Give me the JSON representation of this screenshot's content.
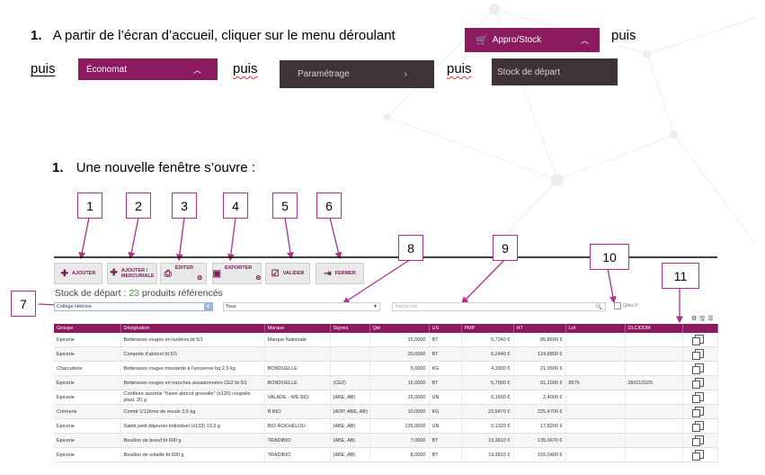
{
  "instructions": {
    "step1_number": "1.",
    "step1_text": "A partir de l’écran d’accueil, cliquer sur le menu déroulant",
    "puis": "puis",
    "step2_number": "1.",
    "step2_text": "Une nouvelle fenêtre s’ouvre :"
  },
  "menus": {
    "appro_stock": "Appro/Stock",
    "economat": "Économat",
    "parametrage": "Paramétrage",
    "stock_depart": "Stock de départ"
  },
  "callouts": [
    "1",
    "2",
    "3",
    "4",
    "5",
    "6",
    "7",
    "8",
    "9",
    "10",
    "11"
  ],
  "toolbar": {
    "ajouter": "AJOUTER",
    "ajouter_mercuriale_1": "AJOUTER /",
    "ajouter_mercuriale_2": "MERCURIALE",
    "editer": "ÉDITER",
    "exporter": "EXPORTER",
    "valider": "VALIDER",
    "fermer": "FERMER"
  },
  "app": {
    "title_prefix": "Stock de départ : ",
    "count": "23",
    "title_suffix": " produits référencés",
    "select_site": "Collège Héloïse",
    "select_all": "Tous",
    "search_placeholder": "Recherche",
    "qtes_zero": "Qtés 0"
  },
  "table": {
    "headers": [
      "Groupe",
      "Désignation",
      "Marque",
      "Signes",
      "Qté",
      "US",
      "PMP",
      "HT",
      "Lot",
      "DLC/DDM",
      ""
    ],
    "rows": [
      [
        "Epicerie",
        "Betteraves rouges en lanières bt 5/1",
        "Marque Nationale",
        "",
        "15,0000",
        "BT",
        "5,7240 €",
        "85,8600 €",
        "",
        ""
      ],
      [
        "Epicerie",
        "Compote d'abricot bt 5/1",
        "",
        "",
        "20,0000",
        "BT",
        "6,2440 €",
        "124,8800 €",
        "",
        ""
      ],
      [
        "Charcuterie",
        "Betteraves rouges moutarde à l'ancienne bq 2,5 kg",
        "BONDUELLE",
        "",
        "5,0000",
        "KG",
        "4,3900 €",
        "21,9500 €",
        "",
        ""
      ],
      [
        "Epicerie",
        "Betteraves rouges en tranches assaisonnées CE2 bt 5/1",
        "BONDUELLE",
        "(CE2)",
        "16,0000",
        "BT",
        "5,7000 €",
        "91,2000 €",
        "8576",
        "28/02/2025"
      ],
      [
        "Epicerie",
        "Confiture assortie \"fraise abricot groseille\" (x120) coupelle plast. 20 g",
        "VALADE - WE BIO",
        "(ABE, AB)",
        "15,0000",
        "UN",
        "0,1600 €",
        "2,4000 €",
        "",
        ""
      ],
      [
        "Crémerie",
        "Comté 1/12ème de meule 3,5 kg",
        "R.BIO",
        "(AOP, ABE, AB)",
        "10,0000",
        "KG",
        "22,5470 €",
        "225,4700 €",
        "",
        ""
      ],
      [
        "Epicerie",
        "Sablé petit déjeuner individuel (x133) 13,3 g",
        "BIO ROCHELOU",
        "(ABE, AB)",
        "135,0000",
        "UN",
        "0,1320 €",
        "17,8200 €",
        "",
        ""
      ],
      [
        "Epicerie",
        "Bouillon de boeuf bt 600 g",
        "TRADIBIO",
        "(ABE, AB)",
        "7,0000",
        "BT",
        "19,3810 €",
        "135,6670 €",
        "",
        ""
      ],
      [
        "Epicerie",
        "Bouillon de volaille bt 600 g",
        "TRADIBIO",
        "(ABE, AB)",
        "8,0000",
        "BT",
        "19,3810 €",
        "155,0480 €",
        "",
        ""
      ]
    ]
  }
}
